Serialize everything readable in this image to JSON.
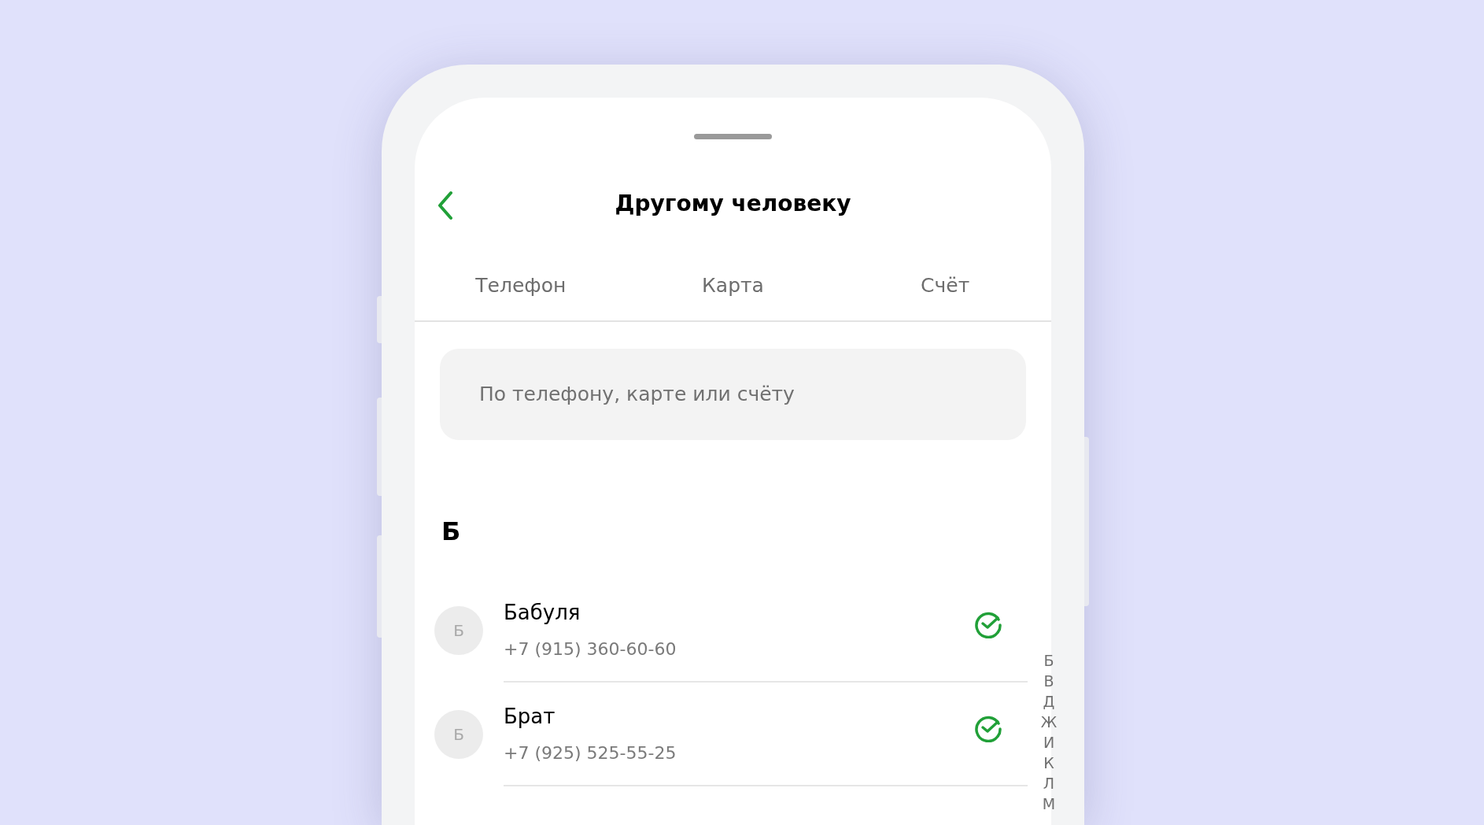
{
  "header": {
    "title": "Другому человеку"
  },
  "tabs": [
    {
      "label": "Телефон"
    },
    {
      "label": "Карта"
    },
    {
      "label": "Счёт"
    }
  ],
  "search": {
    "placeholder": "По телефону, карте или счёту"
  },
  "sections": [
    {
      "letter": "Б",
      "contacts": [
        {
          "initial": "Б",
          "name": "Бабуля",
          "phone": "+7 (915) 360-60-60",
          "verified": true
        },
        {
          "initial": "Б",
          "name": "Брат",
          "phone": "+7 (925) 525-55-25",
          "verified": true
        }
      ]
    }
  ],
  "index_letters": [
    "Б",
    "В",
    "Д",
    "Ж",
    "И",
    "К",
    "Л",
    "М"
  ]
}
